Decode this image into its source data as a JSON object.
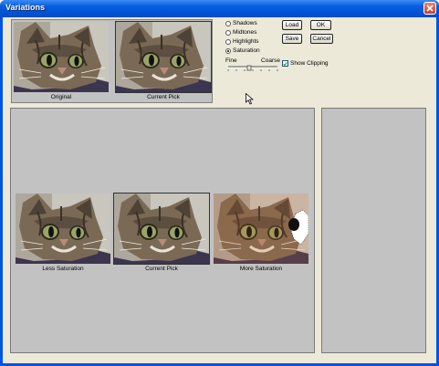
{
  "window": {
    "title": "Variations"
  },
  "top_thumbs": [
    {
      "caption": "Original"
    },
    {
      "caption": "Current Pick"
    }
  ],
  "range": {
    "options": [
      {
        "label": "Shadows",
        "selected": false
      },
      {
        "label": "Midtones",
        "selected": false
      },
      {
        "label": "Highlights",
        "selected": false
      },
      {
        "label": "Saturation",
        "selected": true
      }
    ]
  },
  "buttons": {
    "load": "Load",
    "ok": "OK",
    "save": "Save",
    "cancel": "Cancel"
  },
  "slider": {
    "fine_label": "Fine",
    "coarse_label": "Coarse",
    "position_step": 4,
    "steps": 7
  },
  "show_clipping": {
    "label": "Show Clipping",
    "checked": true
  },
  "variations": [
    {
      "caption": "Less Saturation"
    },
    {
      "caption": "Current Pick"
    },
    {
      "caption": "More Saturation"
    }
  ],
  "colors": {
    "panel": "#c2c2c2",
    "dialog": "#ece9d8",
    "titlebar": "#0054e3",
    "clipping_warning": "#ffffff"
  }
}
